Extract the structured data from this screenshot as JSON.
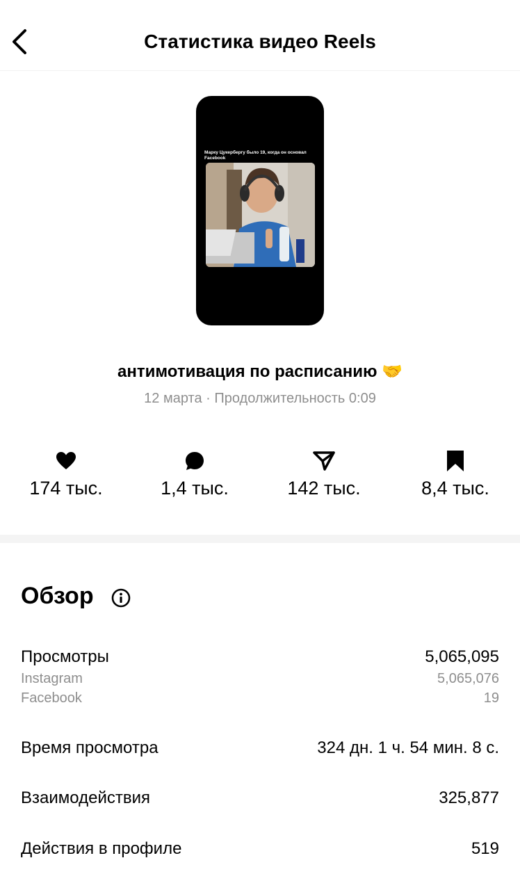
{
  "header": {
    "title": "Статистика видео Reels",
    "back_icon": "chevron-left-icon"
  },
  "reel": {
    "thumbnail_caption": "Марку Цукербергу было 19, когда он основал Facebook",
    "title": "антимотивация по расписанию 🤝",
    "meta": "12 марта · Продолжительность 0:09"
  },
  "stats": [
    {
      "icon": "heart-icon",
      "value": "174 тыс."
    },
    {
      "icon": "comment-icon",
      "value": "1,4 тыс."
    },
    {
      "icon": "share-icon",
      "value": "142 тыс."
    },
    {
      "icon": "bookmark-icon",
      "value": "8,4 тыс."
    }
  ],
  "overview": {
    "title": "Обзор",
    "info_icon": "info-icon",
    "views": {
      "label": "Просмотры",
      "value": "5,065,095",
      "instagram_label": "Instagram",
      "instagram_value": "5,065,076",
      "facebook_label": "Facebook",
      "facebook_value": "19"
    },
    "watch_time": {
      "label": "Время просмотра",
      "value": "324 дн. 1 ч. 54 мин. 8 с."
    },
    "interactions": {
      "label": "Взаимодействия",
      "value": "325,877"
    },
    "profile_actions": {
      "label": "Действия в профиле",
      "value": "519"
    }
  },
  "colors": {
    "text": "#000000",
    "secondary": "#8e8e8e",
    "divider": "#f4f4f4"
  }
}
